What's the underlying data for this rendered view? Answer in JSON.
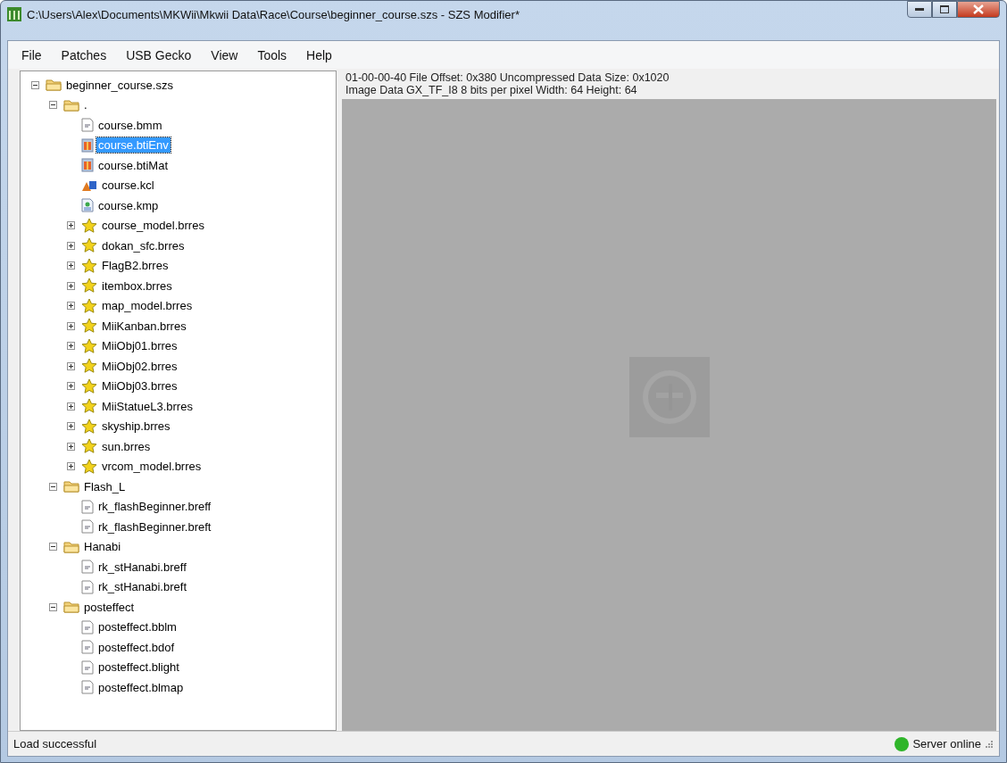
{
  "window": {
    "title": "C:\\Users\\Alex\\Documents\\MKWii\\Mkwii Data\\Race\\Course\\beginner_course.szs - SZS Modifier*"
  },
  "menu": [
    "File",
    "Patches",
    "USB Gecko",
    "View",
    "Tools",
    "Help"
  ],
  "tree": [
    {
      "label": "beginner_course.szs",
      "kind": "folder",
      "expanded": true,
      "selected": false,
      "children": [
        {
          "label": ".",
          "kind": "folder",
          "expanded": true,
          "selected": false,
          "children": [
            {
              "label": "course.bmm",
              "kind": "file",
              "selected": false
            },
            {
              "label": "course.btiEnv",
              "kind": "texture",
              "selected": true
            },
            {
              "label": "course.btiMat",
              "kind": "texture",
              "selected": false
            },
            {
              "label": "course.kcl",
              "kind": "collision",
              "selected": false
            },
            {
              "label": "course.kmp",
              "kind": "kmp",
              "selected": false
            },
            {
              "label": "course_model.brres",
              "kind": "model",
              "expanded": false,
              "selected": false
            },
            {
              "label": "dokan_sfc.brres",
              "kind": "model",
              "expanded": false,
              "selected": false
            },
            {
              "label": "FlagB2.brres",
              "kind": "model",
              "expanded": false,
              "selected": false
            },
            {
              "label": "itembox.brres",
              "kind": "model",
              "expanded": false,
              "selected": false
            },
            {
              "label": "map_model.brres",
              "kind": "model",
              "expanded": false,
              "selected": false
            },
            {
              "label": "MiiKanban.brres",
              "kind": "model",
              "expanded": false,
              "selected": false
            },
            {
              "label": "MiiObj01.brres",
              "kind": "model",
              "expanded": false,
              "selected": false
            },
            {
              "label": "MiiObj02.brres",
              "kind": "model",
              "expanded": false,
              "selected": false
            },
            {
              "label": "MiiObj03.brres",
              "kind": "model",
              "expanded": false,
              "selected": false
            },
            {
              "label": "MiiStatueL3.brres",
              "kind": "model",
              "expanded": false,
              "selected": false
            },
            {
              "label": "skyship.brres",
              "kind": "model",
              "expanded": false,
              "selected": false
            },
            {
              "label": "sun.brres",
              "kind": "model",
              "expanded": false,
              "selected": false
            },
            {
              "label": "vrcom_model.brres",
              "kind": "model",
              "expanded": false,
              "selected": false
            }
          ]
        },
        {
          "label": "Flash_L",
          "kind": "folder",
          "expanded": true,
          "selected": false,
          "children": [
            {
              "label": "rk_flashBeginner.breff",
              "kind": "file",
              "selected": false
            },
            {
              "label": "rk_flashBeginner.breft",
              "kind": "file",
              "selected": false
            }
          ]
        },
        {
          "label": "Hanabi",
          "kind": "folder",
          "expanded": true,
          "selected": false,
          "children": [
            {
              "label": "rk_stHanabi.breff",
              "kind": "file",
              "selected": false
            },
            {
              "label": "rk_stHanabi.breft",
              "kind": "file",
              "selected": false
            }
          ]
        },
        {
          "label": "posteffect",
          "kind": "folder",
          "expanded": true,
          "selected": false,
          "children": [
            {
              "label": "posteffect.bblm",
              "kind": "file",
              "selected": false
            },
            {
              "label": "posteffect.bdof",
              "kind": "file",
              "selected": false
            },
            {
              "label": "posteffect.blight",
              "kind": "file",
              "selected": false
            },
            {
              "label": "posteffect.blmap",
              "kind": "file",
              "selected": false
            }
          ]
        }
      ]
    }
  ],
  "info": [
    "01-00-00-40 File Offset: 0x380 Uncompressed Data Size: 0x1020",
    "Image Data GX_TF_I8 8 bits per pixel Width: 64 Height: 64"
  ],
  "status_bar": {
    "message": "Load successful",
    "server": {
      "label": "Server online",
      "color": "#2fb52a"
    }
  }
}
